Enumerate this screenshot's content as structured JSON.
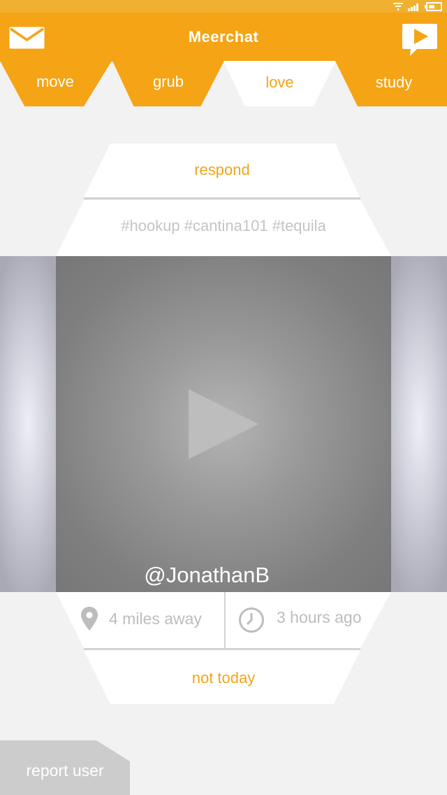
{
  "app": {
    "title": "Meerchat"
  },
  "tabs": [
    {
      "label": "move",
      "active": false
    },
    {
      "label": "grub",
      "active": false
    },
    {
      "label": "love",
      "active": true
    },
    {
      "label": "study",
      "active": false
    }
  ],
  "post": {
    "respond_label": "respond",
    "hashtags": "#hookup #cantina101 #tequila",
    "username": "@JonathanB",
    "distance": "4 miles away",
    "time_ago": "3 hours ago",
    "dismiss_label": "not today"
  },
  "footer": {
    "report_label": "report user"
  },
  "colors": {
    "accent": "#f4a414",
    "background": "#f2f2f2",
    "muted_text": "#bdbdbd"
  },
  "icons": [
    "mail-icon",
    "video-message-icon",
    "wifi-icon",
    "signal-icon",
    "battery-icon",
    "play-icon",
    "location-pin-icon",
    "clock-icon"
  ]
}
